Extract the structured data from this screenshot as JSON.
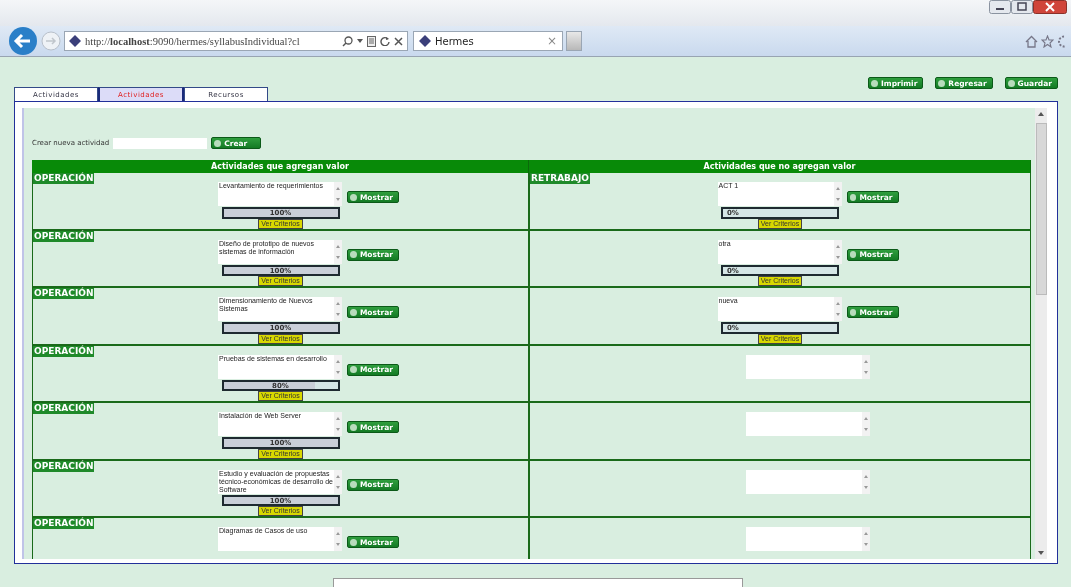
{
  "browser": {
    "url": "http://**localhost**:9090/hermes/syllabusIndividual?cl",
    "tab_title": "Hermes",
    "tab_close": "×"
  },
  "actions": [
    "Imprimir",
    "Regresar",
    "Guardar"
  ],
  "tabs": [
    {
      "label": "Actividades",
      "selected": false
    },
    {
      "label": "Actividades",
      "selected": true
    },
    {
      "label": "Recursos",
      "selected": false
    }
  ],
  "create": {
    "label": "Crear nueva actividad",
    "button": "Crear"
  },
  "columns": [
    {
      "title": "Actividades que agregan valor",
      "rows": [
        {
          "category": "OPERACIÓN",
          "activity": "Levantamiento de requerimientos",
          "button": "Mostrar",
          "progress": {
            "level": 1,
            "reading": "100%"
          },
          "criteria": "Ver Criterios"
        },
        {
          "category": "OPERACIÓN",
          "activity": "Diseño de prototipo de nuevos sistemas de información",
          "button": "Mostrar",
          "progress": {
            "level": 1,
            "reading": "100%"
          },
          "criteria": "Ver Criterios"
        },
        {
          "category": "OPERACIÓN",
          "activity": "Dimensionamiento de Nuevos Sistemas",
          "button": "Mostrar",
          "progress": {
            "level": 1,
            "reading": "100%"
          },
          "criteria": "Ver Criterios"
        },
        {
          "category": "OPERACIÓN",
          "activity": "Pruebas de sistemas en desarrollo",
          "button": "Mostrar",
          "progress": {
            "level": 0.8,
            "reading": "80%"
          },
          "criteria": "Ver Criterios"
        },
        {
          "category": "OPERACIÓN",
          "activity": "Instalación de Web Server",
          "button": "Mostrar",
          "progress": {
            "level": 1,
            "reading": "100%"
          },
          "criteria": "Ver Criterios"
        },
        {
          "category": "OPERACIÓN",
          "activity": "Estudio y evaluación de propuestas técnico-económicas de desarrollo de Software",
          "button": "Mostrar",
          "progress": {
            "level": 1,
            "reading": "100%"
          },
          "criteria": "Ver Criterios"
        },
        {
          "category": "OPERACIÓN",
          "activity": "Diagramas de Casos de uso",
          "button": "Mostrar"
        }
      ]
    },
    {
      "title": "Actividades que no agregan valor",
      "rows": [
        {
          "category": "RETRABAJO",
          "activity": "ACT 1",
          "button": "Mostrar",
          "progress": {
            "reading": "0%"
          },
          "criteria": "Ver Criterios"
        },
        {
          "activity": "otra",
          "button": "Mostrar",
          "progress": {
            "reading": "0%"
          },
          "criteria": "Ver Criterios"
        },
        {
          "activity": "nueva",
          "button": "Mostrar",
          "progress": {
            "reading": "0%"
          },
          "criteria": "Ver Criterios"
        },
        {},
        {},
        {},
        {}
      ]
    }
  ]
}
